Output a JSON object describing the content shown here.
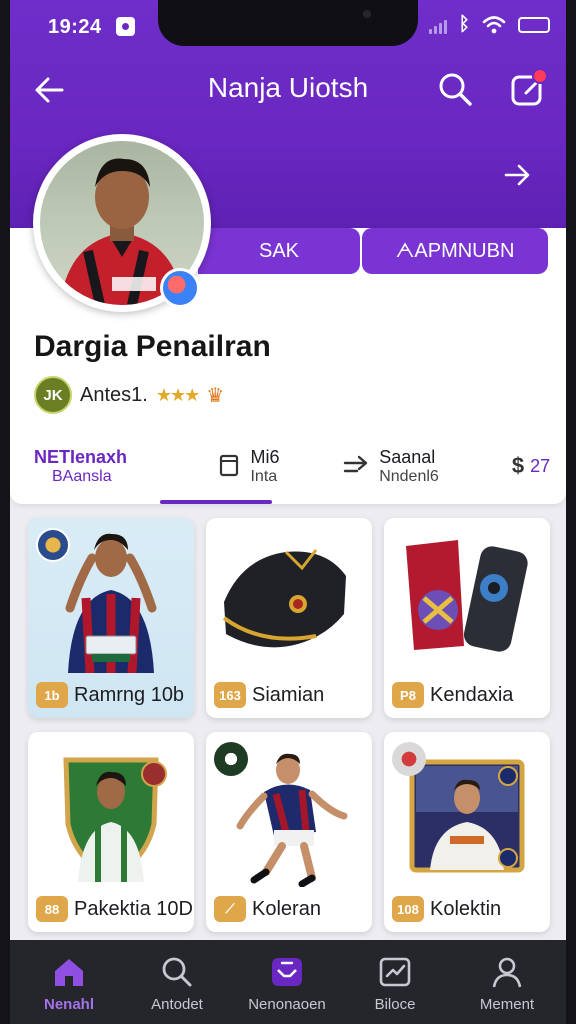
{
  "status_bar": {
    "time": "19:24"
  },
  "header": {
    "title": "Nanja Uiotsh"
  },
  "profile": {
    "tab_1": "SAK",
    "tab_2": "ᗅAPMNUBN",
    "name": "Dargia Penailran",
    "rank_badge": "JK",
    "rank_text": "Antes1.",
    "rank_stars": "★★★"
  },
  "stats": [
    {
      "line1": "NETIenaxh",
      "line2": "BAansla"
    },
    {
      "line1": "Mi6",
      "line2": "Inta"
    },
    {
      "line1": "Saanal",
      "line2": "Nndenl6"
    },
    {
      "line1": "$",
      "line2": "27"
    }
  ],
  "colors": {
    "primary": "#6a27c2",
    "accent_gold": "#e0a74a",
    "nav_bg": "#25252c"
  },
  "grid": [
    {
      "badge": "1b",
      "label": "Ramrng 10b"
    },
    {
      "badge": "163",
      "label": "Siamian"
    },
    {
      "badge": "P8",
      "label": "Kendaxia"
    },
    {
      "badge": "88",
      "label": "Pakektia 10D"
    },
    {
      "badge": "⟋",
      "label": "Koleran"
    },
    {
      "badge": "108",
      "label": "Kolektin"
    }
  ],
  "bottom_nav": [
    {
      "label": "Nenahl",
      "icon": "home-icon"
    },
    {
      "label": "Antodet",
      "icon": "search-icon"
    },
    {
      "label": "Nenonaoen",
      "icon": "inbox-icon"
    },
    {
      "label": "Biloce",
      "icon": "chart-icon"
    },
    {
      "label": "Mement",
      "icon": "profile-icon"
    }
  ]
}
